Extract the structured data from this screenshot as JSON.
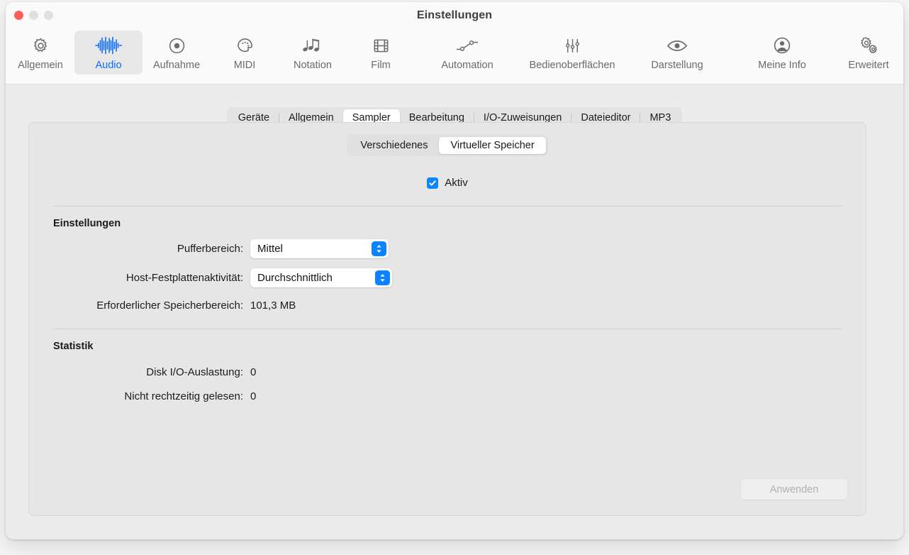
{
  "window": {
    "title": "Einstellungen",
    "traffic_lights": [
      "close",
      "minimize",
      "maximize"
    ]
  },
  "toolbar": {
    "items": [
      {
        "label": "Allgemein",
        "icon": "gear-icon",
        "selected": false
      },
      {
        "label": "Audio",
        "icon": "waveform-icon",
        "selected": true
      },
      {
        "label": "Aufnahme",
        "icon": "record-icon",
        "selected": false
      },
      {
        "label": "MIDI",
        "icon": "midi-plug-icon",
        "selected": false
      },
      {
        "label": "Notation",
        "icon": "music-notes-icon",
        "selected": false
      },
      {
        "label": "Film",
        "icon": "film-strip-icon",
        "selected": false
      },
      {
        "label": "Automation",
        "icon": "automation-icon",
        "selected": false
      },
      {
        "label": "Bedienoberflächen",
        "icon": "sliders-icon",
        "selected": false
      },
      {
        "label": "Darstellung",
        "icon": "eye-icon",
        "selected": false
      },
      {
        "label": "Meine Info",
        "icon": "person-icon",
        "selected": false
      },
      {
        "label": "Erweitert",
        "icon": "double-gear-icon",
        "selected": false
      }
    ],
    "accent_color": "#0a6cff"
  },
  "tabs": [
    {
      "label": "Geräte",
      "selected": false
    },
    {
      "label": "Allgemein",
      "selected": false
    },
    {
      "label": "Sampler",
      "selected": true
    },
    {
      "label": "Bearbeitung",
      "selected": false
    },
    {
      "label": "I/O-Zuweisungen",
      "selected": false
    },
    {
      "label": "Dateieditor",
      "selected": false
    },
    {
      "label": "MP3",
      "selected": false
    }
  ],
  "segmented": [
    {
      "label": "Verschiedenes",
      "selected": false
    },
    {
      "label": "Virtueller Speicher",
      "selected": true
    }
  ],
  "active_checkbox": {
    "label": "Aktiv",
    "checked": true,
    "color": "#0a84ff"
  },
  "settings": {
    "heading": "Einstellungen",
    "buffer_range": {
      "label": "Pufferbereich:",
      "value": "Mittel"
    },
    "host_disk_activity": {
      "label": "Host-Festplattenaktivität:",
      "value": "Durchschnittlich"
    },
    "required_memory": {
      "label": "Erforderlicher Speicherbereich:",
      "value": "101,3 MB"
    }
  },
  "statistics": {
    "heading": "Statistik",
    "disk_io": {
      "label": "Disk I/O-Auslastung:",
      "value": "0"
    },
    "not_read_in_time": {
      "label": "Nicht rechtzeitig gelesen:",
      "value": "0"
    }
  },
  "apply_button": {
    "label": "Anwenden",
    "enabled": false
  }
}
